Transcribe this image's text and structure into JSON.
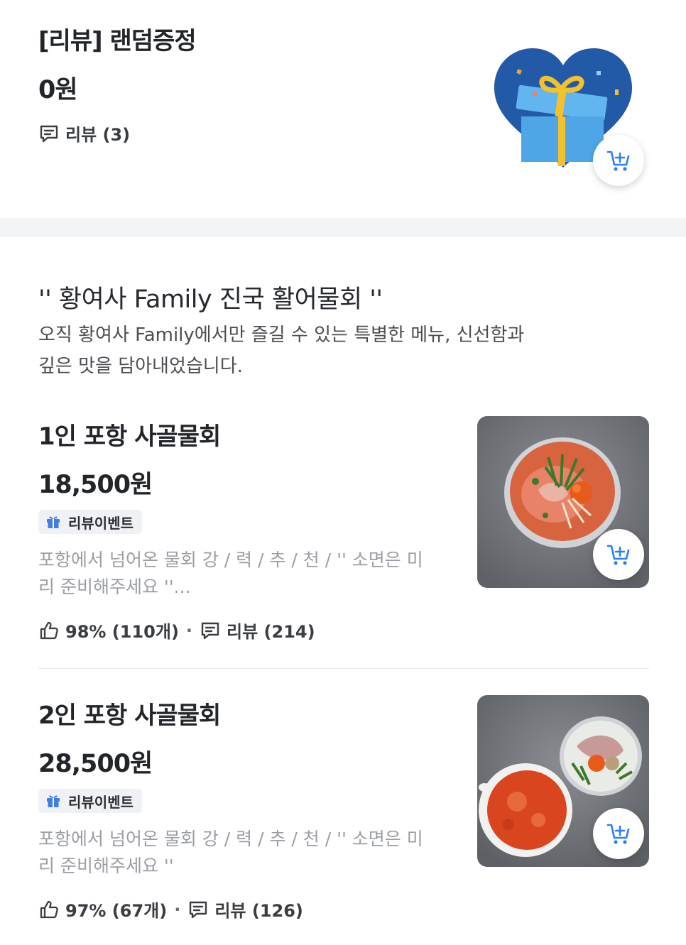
{
  "top_item": {
    "name": "[리뷰] 랜덤증정",
    "price": "0원",
    "reviews": "리뷰 (3)"
  },
  "section": {
    "title": "'' 황여사 Family 진국 활어물회 ''",
    "description": "오직 황여사 Family에서만 즐길 수 있는 특별한 메뉴, 신선함과 깊은 맛을 담아내었습니다."
  },
  "menu_items": [
    {
      "name": "1인 포항 사골물회",
      "price": "18,500원",
      "badge": "리뷰이벤트",
      "description": "포항에서 넘어온 물회 강 / 력 / 추 / 천 / '' 소면은 미리 준비해주세요 ''...",
      "likes": "98% (110개)",
      "reviews": "리뷰 (214)"
    },
    {
      "name": "2인 포항 사골물회",
      "price": "28,500원",
      "badge": "리뷰이벤트",
      "description": "포항에서 넘어온 물회 강 / 력 / 추 / 천 / '' 소면은 미리 준비해주세요 ''",
      "likes": "97% (67개)",
      "reviews": "리뷰 (126)"
    }
  ],
  "icons": {
    "review": "chat-bubble-icon",
    "like": "thumbs-up-icon",
    "badge": "gift-icon",
    "cart": "add-to-cart-icon"
  },
  "colors": {
    "accent": "#2d7ff9",
    "heart": "#235aa8",
    "muted_text": "#9a9ea4",
    "badge_bg": "#eff1f4"
  }
}
